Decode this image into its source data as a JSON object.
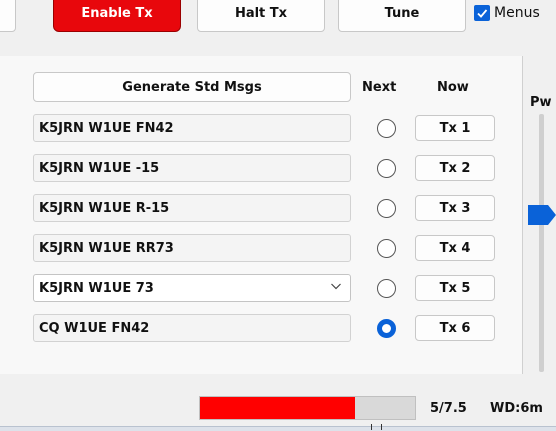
{
  "top_buttons": {
    "enable_tx": "Enable Tx",
    "halt_tx": "Halt Tx",
    "tune": "Tune",
    "menus_label": "Menus",
    "menus_checked": true
  },
  "panel": {
    "generate_label": "Generate Std Msgs",
    "next_header": "Next",
    "now_header": "Now",
    "power_label": "Pw",
    "rows": [
      {
        "message": "K5JRN W1UE FN42",
        "tx_label": "Tx 1",
        "selected": false
      },
      {
        "message": "K5JRN W1UE -15",
        "tx_label": "Tx 2",
        "selected": false
      },
      {
        "message": "K5JRN W1UE R-15",
        "tx_label": "Tx 3",
        "selected": false
      },
      {
        "message": "K5JRN W1UE RR73",
        "tx_label": "Tx 4",
        "selected": false
      },
      {
        "message": "K5JRN W1UE 73",
        "tx_label": "Tx 5",
        "selected": false
      },
      {
        "message": "CQ W1UE FN42",
        "tx_label": "Tx 6",
        "selected": true
      }
    ]
  },
  "status": {
    "progress_fraction": 0.72,
    "progress_color": "#ff0000",
    "period": "5/7.5",
    "watchdog": "WD:6m"
  },
  "colors": {
    "enable_tx_bg": "#e8070c",
    "accent": "#0a62d8"
  }
}
